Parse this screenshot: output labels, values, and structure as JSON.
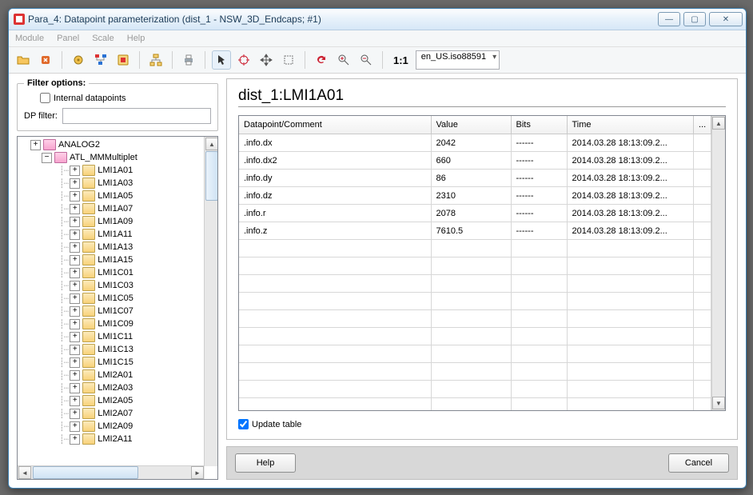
{
  "window": {
    "title": "Para_4: Datapoint parameterization (dist_1 - NSW_3D_Endcaps; #1)"
  },
  "menu": {
    "module": "Module",
    "panel": "Panel",
    "scale": "Scale",
    "help": "Help"
  },
  "toolbar": {
    "locale": "en_US.iso88591",
    "ratio": "1:1"
  },
  "filter": {
    "legend": "Filter options:",
    "internal_label": "Internal datapoints",
    "dp_label": "DP filter:",
    "dp_value": ""
  },
  "tree": {
    "root": "ANALOG2",
    "parent": "ATL_MMMultiplet",
    "children": [
      "LMI1A01",
      "LMI1A03",
      "LMI1A05",
      "LMI1A07",
      "LMI1A09",
      "LMI1A11",
      "LMI1A13",
      "LMI1A15",
      "LMI1C01",
      "LMI1C03",
      "LMI1C05",
      "LMI1C07",
      "LMI1C09",
      "LMI1C11",
      "LMI1C13",
      "LMI1C15",
      "LMI2A01",
      "LMI2A03",
      "LMI2A05",
      "LMI2A07",
      "LMI2A09",
      "LMI2A11"
    ]
  },
  "detail": {
    "heading": "dist_1:LMI1A01",
    "columns": {
      "dp": "Datapoint/Comment",
      "value": "Value",
      "bits": "Bits",
      "time": "Time",
      "more": "..."
    },
    "rows": [
      {
        "dp": ".info.dx",
        "value": "2042",
        "bits": "------",
        "time": "2014.03.28 18:13:09.2..."
      },
      {
        "dp": ".info.dx2",
        "value": "660",
        "bits": "------",
        "time": "2014.03.28 18:13:09.2..."
      },
      {
        "dp": ".info.dy",
        "value": "86",
        "bits": "------",
        "time": "2014.03.28 18:13:09.2..."
      },
      {
        "dp": ".info.dz",
        "value": "2310",
        "bits": "------",
        "time": "2014.03.28 18:13:09.2..."
      },
      {
        "dp": ".info.r",
        "value": "2078",
        "bits": "------",
        "time": "2014.03.28 18:13:09.2..."
      },
      {
        "dp": ".info.z",
        "value": "7610.5",
        "bits": "------",
        "time": "2014.03.28 18:13:09.2..."
      }
    ],
    "update_label": "Update table"
  },
  "buttons": {
    "help": "Help",
    "cancel": "Cancel"
  }
}
